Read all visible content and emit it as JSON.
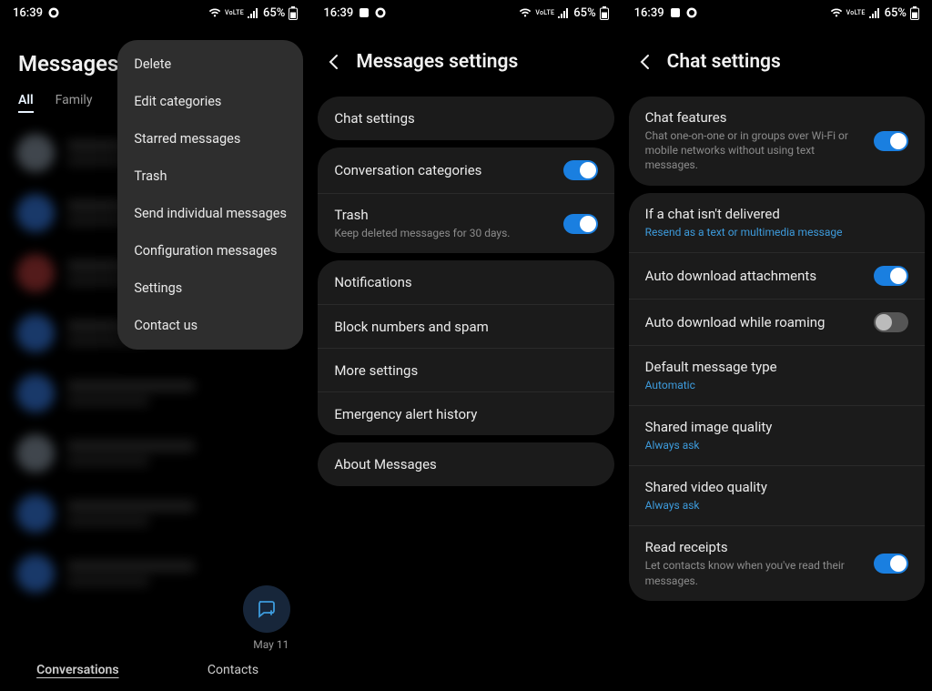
{
  "status": {
    "time": "16:39",
    "battery": "65%"
  },
  "screen1": {
    "title": "Messages",
    "tabs": [
      "All",
      "Family"
    ],
    "menu": [
      "Delete",
      "Edit categories",
      "Starred messages",
      "Trash",
      "Send individual messages",
      "Configuration messages",
      "Settings",
      "Contact us"
    ],
    "fab_date": "May 11",
    "bottom_tabs": [
      "Conversations",
      "Contacts"
    ]
  },
  "screen2": {
    "title": "Messages settings",
    "group1": {
      "chat_settings": "Chat settings"
    },
    "group2": {
      "conv_cat": "Conversation categories",
      "trash_title": "Trash",
      "trash_sub": "Keep deleted messages for 30 days."
    },
    "group3": {
      "notifications": "Notifications",
      "block": "Block numbers and spam",
      "more": "More settings",
      "emergency": "Emergency alert history"
    },
    "group4": {
      "about": "About Messages"
    }
  },
  "screen3": {
    "title": "Chat settings",
    "group1": {
      "chat_features_title": "Chat features",
      "chat_features_sub": "Chat one-on-one or in groups over Wi-Fi or mobile networks without using text messages."
    },
    "group2": {
      "not_delivered_title": "If a chat isn't delivered",
      "not_delivered_sub": "Resend as a text or multimedia message",
      "auto_dl": "Auto download attachments",
      "auto_dl_roam": "Auto download while roaming",
      "default_msg_title": "Default message type",
      "default_msg_sub": "Automatic",
      "img_q_title": "Shared image quality",
      "img_q_sub": "Always ask",
      "vid_q_title": "Shared video quality",
      "vid_q_sub": "Always ask",
      "read_title": "Read receipts",
      "read_sub": "Let contacts know when you've read their messages."
    }
  }
}
